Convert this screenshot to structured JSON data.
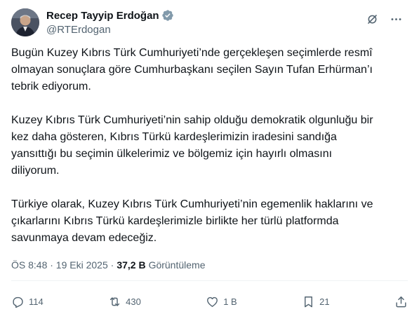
{
  "author": {
    "name": "Recep Tayyip Erdoğan",
    "handle": "@RTErdogan"
  },
  "icons": {
    "verified": "verified-badge-icon",
    "grok": "grok-icon",
    "more": "more-icon",
    "reply": "reply-icon",
    "repost": "repost-icon",
    "like": "like-icon",
    "bookmark": "bookmark-icon",
    "share": "share-icon"
  },
  "colors": {
    "text": "#0f1419",
    "secondary": "#536471",
    "verified": "#829aab",
    "divider": "#eff3f4"
  },
  "tweet": {
    "paragraphs": [
      {
        "lines": [
          "Bugün Kuzey Kıbrıs Türk Cumhuriyeti’nde gerçekleşen seçimlerde resmî",
          "olmayan sonuçlara göre Cumhurbaşkanı seçilen Sayın Tufan Erhürman’ı",
          "tebrik ediyorum."
        ]
      },
      {
        "lines": [
          "Kuzey Kıbrıs Türk Cumhuriyeti’nin sahip olduğu demokratik olgunluğu bir",
          "kez daha gösteren, Kıbrıs Türkü kardeşlerimizin iradesini sandığa",
          "yansıttığı bu seçimin ülkelerimiz ve bölgemiz için hayırlı olmasını",
          "diliyorum."
        ]
      },
      {
        "lines": [
          "Türkiye olarak, Kuzey Kıbrıs Türk Cumhuriyeti’nin egemenlik haklarını ve",
          "çıkarlarını Kıbrıs Türkü kardeşlerimizle birlikte her türlü platformda",
          "savunmaya devam edeceğiz."
        ]
      }
    ],
    "timestamp": "ÖS 8:48 · 19 Eki 2025 ·",
    "views_count": "37,2 B",
    "views_label": "Görüntüleme"
  },
  "actions": {
    "replies": "114",
    "reposts": "430",
    "likes": "1 B",
    "bookmarks": "21"
  }
}
